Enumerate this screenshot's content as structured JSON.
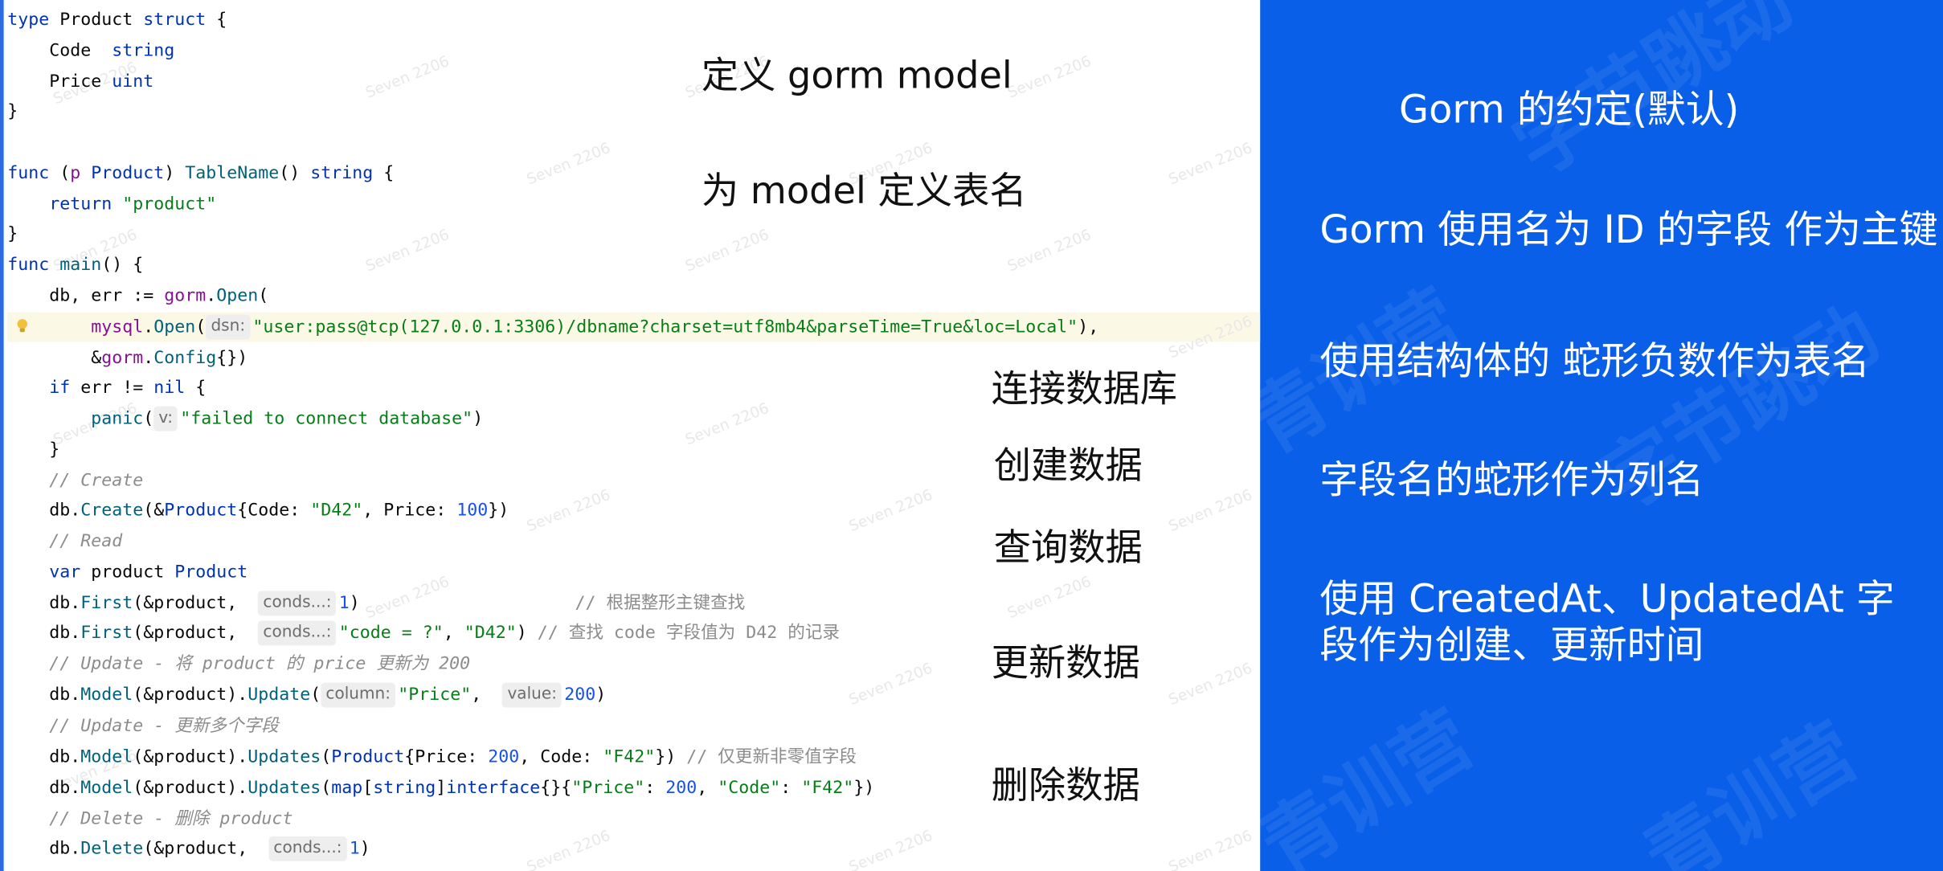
{
  "code": {
    "l1_kw": "type",
    "l1_name": " Product ",
    "l1_kw2": "struct",
    "l1_rest": " {",
    "l2_field": "    Code  ",
    "l2_type": "string",
    "l3_field": "    Price ",
    "l3_type": "uint",
    "l4": "}",
    "l6_kw": "func",
    "l6_a": " (",
    "l6_p": "p",
    "l6_b": " ",
    "l6_ty": "Product",
    "l6_c": ") ",
    "l6_fn": "TableName",
    "l6_d": "() ",
    "l6_kw2": "string",
    "l6_e": " {",
    "l7_kw": "    return",
    "l7_sp": " ",
    "l7_str": "\"product\"",
    "l8": "}",
    "l9_kw": "func",
    "l9_sp": " ",
    "l9_fn": "main",
    "l9_rest": "() {",
    "l10_a": "    db, err := ",
    "l10_pkg": "gorm",
    "l10_dot": ".",
    "l10_fn": "Open",
    "l10_b": "(",
    "l11_a": "        ",
    "l11_pkg": "mysql",
    "l11_dot": ".",
    "l11_fn": "Open",
    "l11_b": "(",
    "l11_hint": "dsn:",
    "l11_str": "\"user:pass@tcp(127.0.0.1:3306)/dbname?charset=utf8mb4&parseTime=True&loc=Local\"",
    "l11_c": "),",
    "l12_a": "        &",
    "l12_pkg": "gorm",
    "l12_dot": ".",
    "l12_fn": "Config",
    "l12_b": "{})",
    "l13_kw": "    if",
    "l13_a": " err != ",
    "l13_kw2": "nil",
    "l13_b": " {",
    "l14_a": "        ",
    "l14_fn": "panic",
    "l14_b": "(",
    "l14_hint": "v:",
    "l14_str": "\"failed to connect database\"",
    "l14_c": ")",
    "l15": "    }",
    "l16_cmt": "    // Create",
    "l17_a": "    db.",
    "l17_fn": "Create",
    "l17_b": "(&",
    "l17_ty": "Product",
    "l17_c": "{Code: ",
    "l17_str": "\"D42\"",
    "l17_d": ", Price: ",
    "l17_num": "100",
    "l17_e": "})",
    "l18_cmt": "    // Read",
    "l19_kw": "    var",
    "l19_a": " product ",
    "l19_ty": "Product",
    "l20_a": "    db.",
    "l20_fn": "First",
    "l20_b": "(&product,  ",
    "l20_hint": "conds...:",
    "l20_num": "1",
    "l20_c": ")",
    "l20_cmt": "// 根据整形主键查找",
    "l21_a": "    db.",
    "l21_fn": "First",
    "l21_b": "(&product,  ",
    "l21_hint": "conds...:",
    "l21_str": "\"code = ?\"",
    "l21_c": ", ",
    "l21_str2": "\"D42\"",
    "l21_d": ") ",
    "l21_cmt": "// 查找 code 字段值为 D42 的记录",
    "l22_cmt": "    // Update - 将 product 的 price 更新为 200",
    "l23_a": "    db.",
    "l23_fn": "Model",
    "l23_b": "(&product).",
    "l23_fn2": "Update",
    "l23_c": "(",
    "l23_hint": "column:",
    "l23_str": "\"Price\"",
    "l23_d": ",  ",
    "l23_hint2": "value:",
    "l23_num": "200",
    "l23_e": ")",
    "l24_cmt": "    // Update - 更新多个字段",
    "l25_a": "    db.",
    "l25_fn": "Model",
    "l25_b": "(&product).",
    "l25_fn2": "Updates",
    "l25_c": "(",
    "l25_ty": "Product",
    "l25_d": "{Price: ",
    "l25_num": "200",
    "l25_e": ", Code: ",
    "l25_str": "\"F42\"",
    "l25_f": "}) ",
    "l25_cmt": "// 仅更新非零值字段",
    "l26_a": "    db.",
    "l26_fn": "Model",
    "l26_b": "(&product).",
    "l26_fn2": "Updates",
    "l26_c": "(",
    "l26_kw": "map",
    "l26_d": "[",
    "l26_kw2": "string",
    "l26_e": "]",
    "l26_kw3": "interface",
    "l26_f": "{}{",
    "l26_str": "\"Price\"",
    "l26_g": ": ",
    "l26_num": "200",
    "l26_h": ", ",
    "l26_str2": "\"Code\"",
    "l26_i": ": ",
    "l26_str3": "\"F42\"",
    "l26_j": "})",
    "l27_cmt": "    // Delete - 删除 product",
    "l28_a": "    db.",
    "l28_fn": "Delete",
    "l28_b": "(&product,  ",
    "l28_hint": "conds...:",
    "l28_num": "1",
    "l28_c": ")"
  },
  "annotations": {
    "define_model": "定义 gorm model",
    "define_table": "为 model 定义表名",
    "connect_db": "连接数据库",
    "create_data": "创建数据",
    "query_data": "查询数据",
    "update_data": "更新数据",
    "delete_data": "删除数据"
  },
  "conventions": {
    "title": "Gorm  的约定(默认)",
    "item1": "Gorm 使用名为 ID 的字段 作为主键",
    "item2": "使用结构体的 蛇形负数作为表名",
    "item3": "字段名的蛇形作为列名",
    "item4_line1": "使用 CreatedAt、UpdatedAt 字",
    "item4_line2": "段作为创建、更新时间"
  },
  "watermarks": {
    "text": "Seven 2206",
    "big1": "字节跳动",
    "big2": "青训营"
  },
  "colors": {
    "right_bg": "#0a5fe8",
    "keyword": "#0033b3",
    "string": "#067d17",
    "number": "#1750eb",
    "function": "#00627a",
    "comment": "#8c8c8c"
  }
}
